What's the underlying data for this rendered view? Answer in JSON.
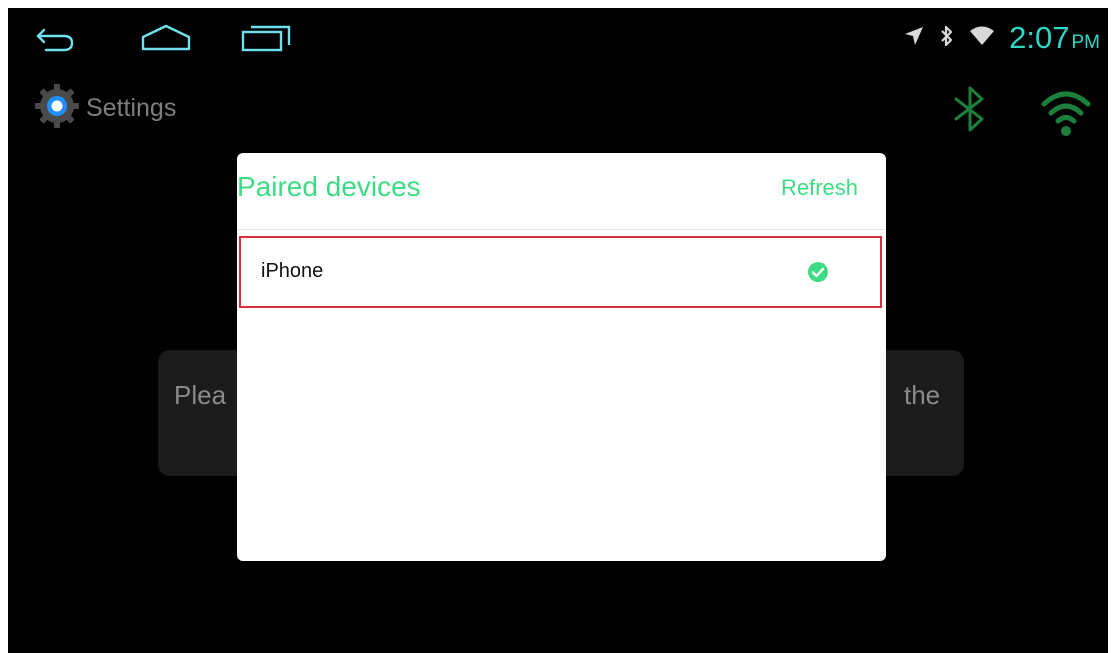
{
  "status_bar": {
    "time": "2:07",
    "ampm": "PM",
    "icons": [
      "back-icon",
      "home-icon",
      "recent-apps-icon",
      "location-icon",
      "bluetooth-icon",
      "wifi-icon"
    ]
  },
  "app": {
    "title": "Settings",
    "background_text_left": "Plea",
    "background_text_right": "the"
  },
  "dialog": {
    "title": "Paired devices",
    "refresh_label": "Refresh",
    "devices": [
      {
        "name": "iPhone",
        "connected": true
      }
    ]
  },
  "colors": {
    "accent_green": "#3ddc84",
    "clock_cyan": "#2fd6c6",
    "selection_red": "#d6303a"
  }
}
